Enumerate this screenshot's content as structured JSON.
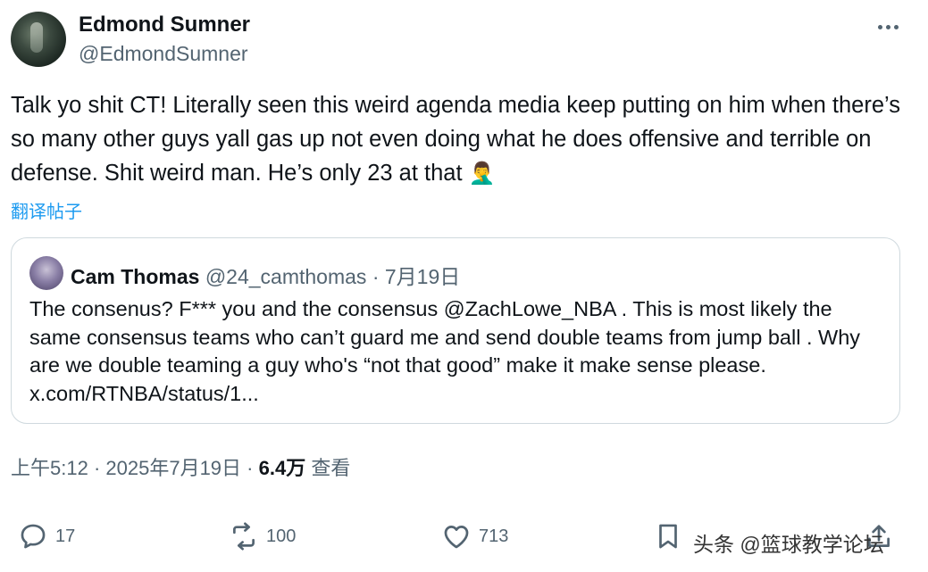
{
  "author": {
    "display_name": "Edmond Sumner",
    "handle": "@EdmondSumner"
  },
  "tweet": {
    "text": "Talk yo shit CT! Literally seen this weird agenda media keep putting on him when there’s so many other guys yall gas up not even doing what he does offensive and terrible on defense. Shit weird man. He’s only 23 at that",
    "emoji": "🤦‍♂️",
    "translate_label": "翻译帖子"
  },
  "quote": {
    "display_name": "Cam Thomas",
    "handle": "@24_camthomas",
    "separator": "·",
    "date": "7月19日",
    "text": "The consenus? F*** you and the consensus @ZachLowe_NBA . This is most likely the same consensus teams who can’t guard me and send double teams from jump ball . Why are we double teaming a guy who's “not that good” make it make sense please. x.com/RTNBA/status/1..."
  },
  "meta": {
    "time": "上午5:12",
    "sep1": " · ",
    "date": "2025年7月19日",
    "sep2": " · ",
    "views": "6.4万",
    "views_label": " 查看"
  },
  "actions": {
    "reply_count": "17",
    "retweet_count": "100",
    "like_count": "713"
  },
  "watermark": "头条 @篮球教学论坛",
  "icons": {
    "more": "more-horizontal-icon",
    "reply": "reply-icon",
    "retweet": "retweet-icon",
    "like": "heart-icon",
    "bookmark": "bookmark-icon",
    "share": "share-icon"
  },
  "colors": {
    "text": "#0f1419",
    "secondary": "#536471",
    "link": "#1d9bf0",
    "border": "#cfd9de"
  }
}
